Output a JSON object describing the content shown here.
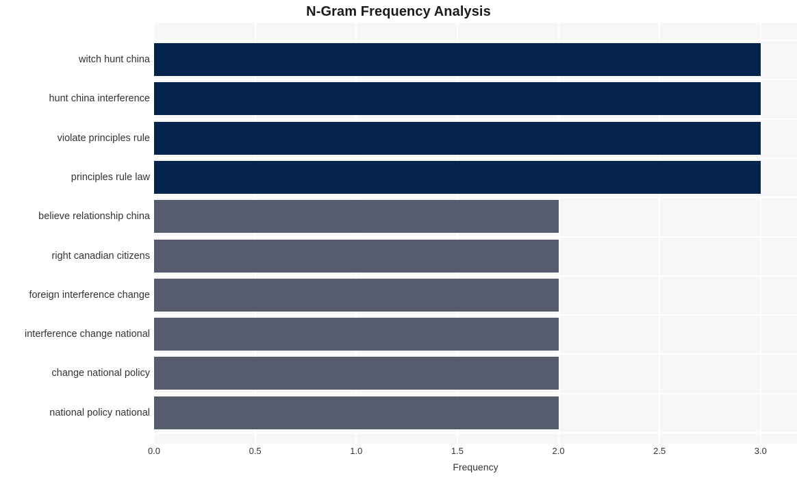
{
  "chart_data": {
    "type": "bar",
    "orientation": "horizontal",
    "title": "N-Gram Frequency Analysis",
    "xlabel": "Frequency",
    "ylabel": "",
    "categories": [
      "witch hunt china",
      "hunt china interference",
      "violate principles rule",
      "principles rule law",
      "believe relationship china",
      "right canadian citizens",
      "foreign interference change",
      "interference change national",
      "change national policy",
      "national policy national"
    ],
    "values": [
      3,
      3,
      3,
      3,
      2,
      2,
      2,
      2,
      2,
      2
    ],
    "bar_colors": [
      "#04234d",
      "#04234d",
      "#04234d",
      "#04234d",
      "#565b6e",
      "#565b6e",
      "#565b6e",
      "#565b6e",
      "#565b6e",
      "#565b6e"
    ],
    "xlim": [
      0.0,
      3.18
    ],
    "xticks": [
      0.0,
      0.5,
      1.0,
      1.5,
      2.0,
      2.5,
      3.0
    ],
    "xtick_labels": [
      "0.0",
      "0.5",
      "1.0",
      "1.5",
      "2.0",
      "2.5",
      "3.0"
    ],
    "grid": true,
    "grid_color": "#ffffff",
    "plot_background": "#f7f7f7",
    "figure_background": "#ffffff",
    "legend": null,
    "annotations": []
  },
  "colors": {
    "accent_high": "#04234d",
    "accent_low": "#565b6e",
    "text": "#333333",
    "title": "#1a1a1a"
  }
}
